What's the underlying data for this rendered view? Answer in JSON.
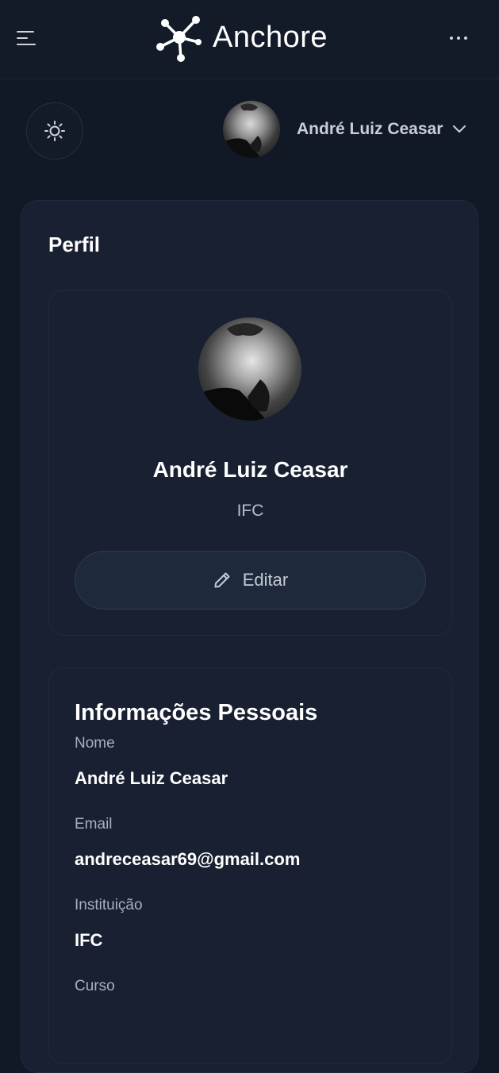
{
  "header": {
    "brand": "Anchore",
    "menu_icon": "hamburger-menu-icon",
    "more_icon": "more-dots-icon"
  },
  "toolbar": {
    "theme_icon": "sun-icon",
    "user_name": "André Luiz Ceasar",
    "user_chevron_icon": "chevron-down-icon"
  },
  "profile": {
    "title": "Perfil",
    "name": "André Luiz Ceasar",
    "institution": "IFC",
    "edit_label": "Editar",
    "edit_icon": "pencil-icon"
  },
  "personal_info": {
    "title": "Informações Pessoais",
    "fields": [
      {
        "label": "Nome",
        "value": "André Luiz Ceasar"
      },
      {
        "label": "Email",
        "value": "andreceasar69@gmail.com"
      },
      {
        "label": "Instituição",
        "value": "IFC"
      },
      {
        "label": "Curso",
        "value": ""
      }
    ]
  },
  "colors": {
    "background": "#111826",
    "card": "#182031",
    "border": "#222b3d",
    "text_primary": "#ffffff",
    "text_secondary": "#a8b0bd"
  }
}
